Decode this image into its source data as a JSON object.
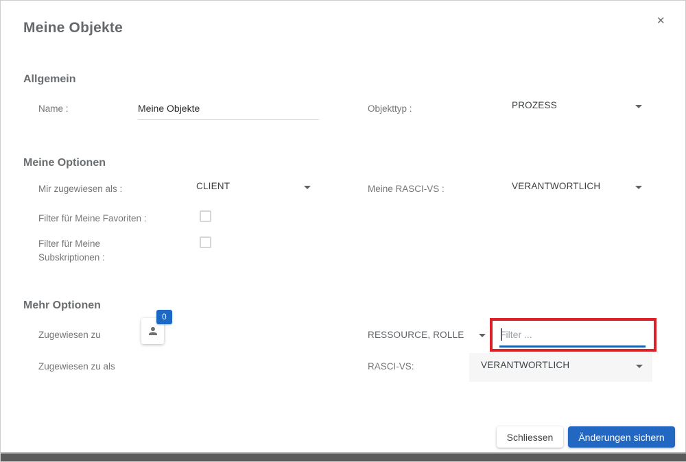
{
  "dialog": {
    "title": "Meine Objekte",
    "close_glyph": "✕"
  },
  "sections": {
    "allgemein": {
      "heading": "Allgemein",
      "name_label": "Name :",
      "name_value": "Meine Objekte",
      "objekttyp_label": "Objekttyp :",
      "objekttyp_value": "PROZESS"
    },
    "meine_optionen": {
      "heading": "Meine Optionen",
      "mir_zugewiesen_label": "Mir zugewiesen als :",
      "mir_zugewiesen_value": "CLIENT",
      "meine_rasci_label": "Meine RASCI-VS :",
      "meine_rasci_value": "VERANTWORTLICH",
      "favoriten_label": "Filter für Meine Favoriten :",
      "subskriptionen_label": "Filter für Meine Subskriptionen :"
    },
    "mehr_optionen": {
      "heading": "Mehr Optionen",
      "zugewiesen_zu_label": "Zugewiesen zu",
      "badge_count": "0",
      "ressource_rolle_value": "RESSOURCE, ROLLE",
      "filter_placeholder": "Filter ...",
      "zugewiesen_zu_als_label": "Zugewiesen zu als",
      "rasci_vs_label": "RASCI-VS:",
      "rasci_vs_value": "VERANTWORTLICH"
    }
  },
  "footer": {
    "close_label": "Schliessen",
    "save_label": "Änderungen sichern"
  },
  "colors": {
    "accent_blue": "#2268c2",
    "underline_blue": "#1a5fb4",
    "badge_blue": "#1e68c5",
    "highlight_red": "#dd2025"
  }
}
